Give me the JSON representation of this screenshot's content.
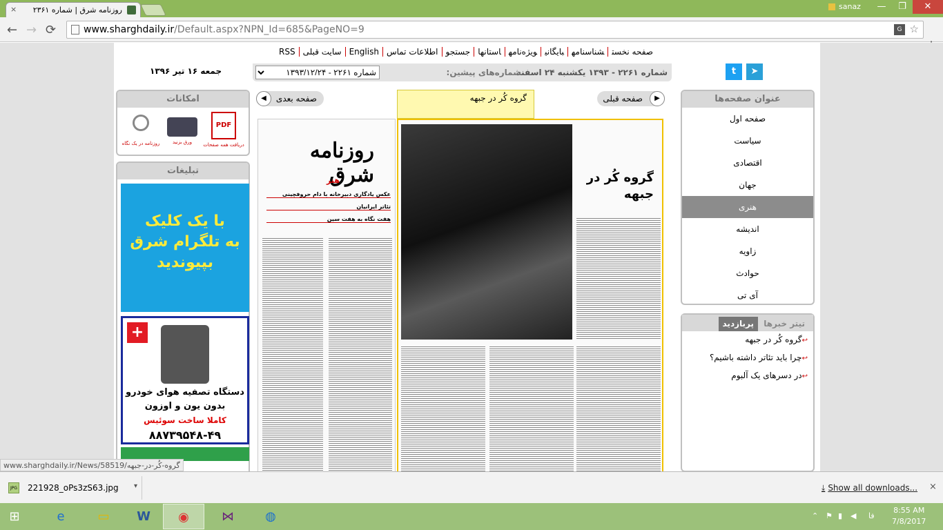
{
  "browser": {
    "tab_title": "روزنامه شرق | شماره ۲۳۶۱",
    "tab_close": "×",
    "user": "sanaz",
    "url_host": "www.sharghdaily.ir",
    "url_path": "/Default.aspx?NPN_Id=685&PageNO=9",
    "back": "←",
    "forward": "→",
    "reload": "⟳",
    "status_url": "www.sharghdaily.ir/News/58519/گروه-کُر-در-جبهه"
  },
  "site": {
    "nav": [
      "صفحه نخست",
      "شناسنامه",
      "بایگانی",
      "ویژه‌نامه",
      "استانها",
      "جستجو",
      "اطلاعات تماس",
      "English",
      "سایت قبلی",
      "RSS"
    ],
    "date": "جمعه ۱۶ تیر ۱۳۹۶",
    "current_issue": "شماره ۲۲۶۱ - ۱۳۹۳ یکشنبه ۲۴ اسفند",
    "prev_issues_label": "شماره‌های پیشین:",
    "prev_issue_value": "شماره ۲۲۶۱ - ۱۳۹۳/۱۲/۲۴",
    "twitter": "t",
    "telegram": "➤"
  },
  "tools": {
    "header": "امکانات",
    "items": [
      {
        "label": "دریافت همه صفحات",
        "icon": "pdf-icon"
      },
      {
        "label": "ورق بزنید",
        "icon": "book-icon"
      },
      {
        "label": "روزنامه در یک نگاه",
        "icon": "magnifier-icon"
      }
    ]
  },
  "ads": {
    "header": "تبلیغات",
    "telegram_ad": [
      "با یک کلیک",
      "به تلگرام شرق",
      "بپیوندید"
    ],
    "purifier_ad": {
      "line1": "دستگاه تصفیه هوای خودرو",
      "line2": "بدون یون و اوزون",
      "line3": "کاملا ساخت سوئیس",
      "phone": "۸۸۷۳۹۵۴۸-۴۹",
      "flag": "+"
    }
  },
  "pager": {
    "next": "صفحه بعدی",
    "prev": "صفحه قبلی",
    "next_arrow": "◀",
    "prev_arrow": "▶"
  },
  "callout": "گروه کُر در جبهه",
  "paper": {
    "masthead": "روزنامه شرق",
    "section": "هنر",
    "headline": "گروه کُر در جبهه",
    "toc": [
      "عکس یادگاری دبیرخانه با دام حروفچینی",
      "تئاتر ایرانیان",
      "هفت نگاه به هفت سین"
    ]
  },
  "pages": {
    "header": "عنوان صفحه‌ها",
    "items": [
      "صفحه اول",
      "سیاست",
      "اقتصادی",
      "جهان",
      "هنری",
      "اندیشه",
      "زاویه",
      "حوادث",
      "آی تی"
    ],
    "selected": "هنری"
  },
  "news": {
    "tab_active": "پربازدید",
    "tab_other": "تیتر خبرها",
    "items": [
      "گروه کُر در جبهه",
      "چرا باید تئاتر داشته باشیم؟",
      "در دسرهای یک آلبوم"
    ]
  },
  "download": {
    "file": "221928_oPs3zS63.jpg",
    "file_type": "JPG",
    "show_all": "Show all downloads...",
    "close": "×",
    "menu": "▾",
    "download_arrow": "⤓"
  },
  "taskbar": {
    "time": "8:55 AM",
    "date": "7/8/2017",
    "lang": "فا"
  },
  "colors": {
    "chrome": "#8fb85a",
    "accent": "#c00",
    "telegram_ad": "#1ba3e0"
  }
}
